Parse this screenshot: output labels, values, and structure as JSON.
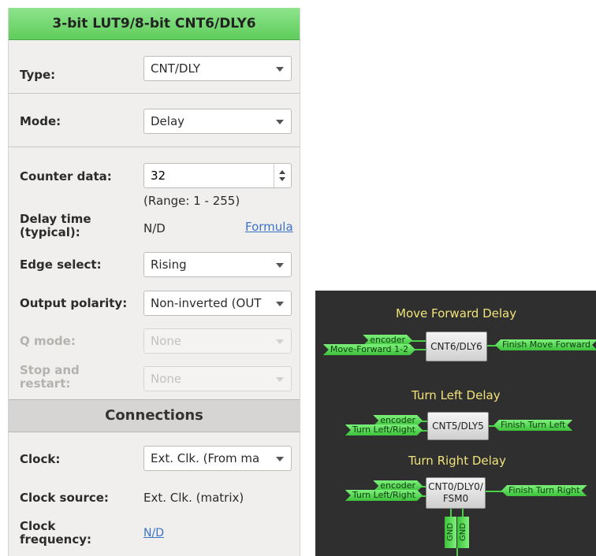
{
  "panel": {
    "header": "3-bit LUT9/8-bit CNT6/DLY6",
    "type_label": "Type:",
    "type_value": "CNT/DLY",
    "mode_label": "Mode:",
    "mode_value": "Delay",
    "counter_label": "Counter data:",
    "counter_value": "32",
    "range_text": "(Range:  1 - 255)",
    "delay_label_1": "Delay time",
    "delay_label_2": "(typical):",
    "delay_value": "N/D",
    "formula_link": "Formula",
    "edge_label": "Edge select:",
    "edge_value": "Rising",
    "polarity_label": "Output polarity:",
    "polarity_value": "Non-inverted (OUT",
    "qmode_label": "Q mode:",
    "qmode_value": "None",
    "stop_label_1": "Stop and",
    "stop_label_2": "restart:",
    "stop_value": "None",
    "connections_header": "Connections",
    "clock_label": "Clock:",
    "clock_value": "Ext. Clk. (From ma",
    "clock_source_label": "Clock source:",
    "clock_source_value": "Ext. Clk. (matrix)",
    "clock_freq_label_1": "Clock",
    "clock_freq_label_2": "frequency:",
    "clock_freq_value": "N/D"
  },
  "schematic": {
    "move": {
      "title": "Move Forward Delay",
      "block": "CNT6/DLY6",
      "in_top": "encoder",
      "in_bottom": "Move-Forward 1-2",
      "out": "Finish Move Forward"
    },
    "left": {
      "title": "Turn Left Delay",
      "block": "CNT5/DLY5",
      "in_top": "encoder",
      "in_bottom": "Turn Left/Right",
      "out": "Finish Turn Left"
    },
    "right": {
      "title": "Turn Right Delay",
      "block_line1": "CNT0/DLY0/",
      "block_line2": "FSM0",
      "in_top": "encoder",
      "in_bottom": "Turn Left/Right",
      "out": "Finish Turn Right",
      "gnd1": "GND",
      "gnd2": "GND"
    }
  },
  "colors": {
    "header_green": "#5fcd5c",
    "net_green": "#3ec23c",
    "title_yellow": "#f1e37a",
    "schematic_bg": "#2f2f2f",
    "link_blue": "#3b73c4"
  }
}
